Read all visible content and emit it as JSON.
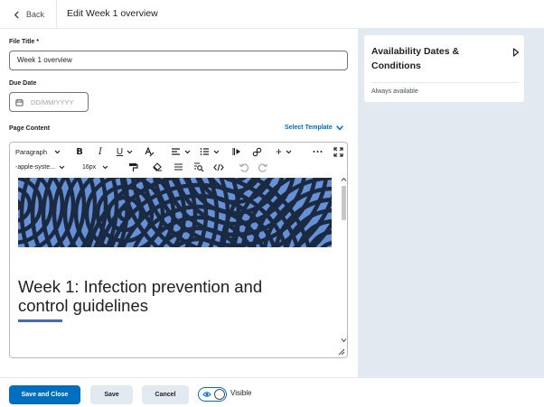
{
  "header": {
    "back_label": "Back",
    "page_title": "Edit Week 1 overview"
  },
  "form": {
    "file_title_label": "File Title *",
    "file_title_value": "Week 1 overview",
    "due_date_label": "Due Date",
    "due_date_placeholder": "DD/MM/YYYY",
    "page_content_label": "Page Content",
    "select_template_label": "Select Template"
  },
  "editor": {
    "toolbar": {
      "format_block": "Paragraph",
      "font_family": "-apple-syste...",
      "font_size": "16px"
    },
    "content": {
      "heading_line1": "Week 1: Infection prevention and",
      "heading_line2": "control guidelines"
    },
    "colors": {
      "banner_light": "#6890d6",
      "banner_dark": "#1b2a43",
      "accent_underline": "#4d67b4"
    }
  },
  "availability": {
    "title_line1": "Availability Dates &",
    "title_line2": "Conditions",
    "subtitle": "Always available"
  },
  "footer": {
    "save_close_label": "Save and Close",
    "save_label": "Save",
    "cancel_label": "Cancel",
    "visibility_label": "Visible",
    "visibility_on": true
  },
  "colors": {
    "primary": "#006fbf",
    "panel_bg": "#e3e9f1"
  }
}
